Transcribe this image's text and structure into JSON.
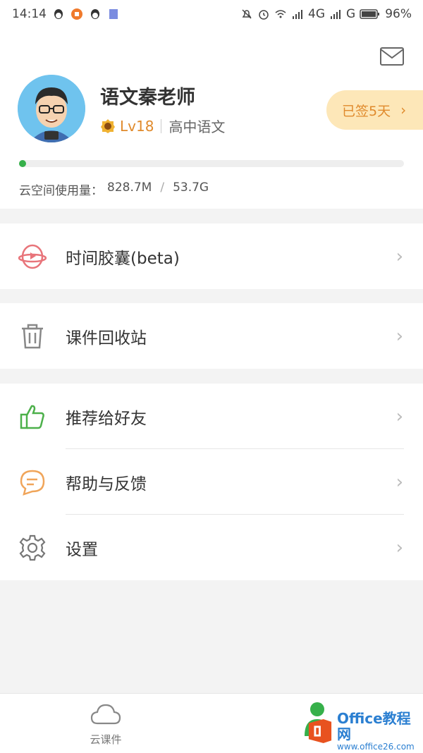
{
  "status_bar": {
    "time": "14:14",
    "network": "4G",
    "network2": "G",
    "battery": "96%"
  },
  "profile": {
    "name": "语文秦老师",
    "level": "Lv18",
    "subject": "高中语文",
    "checkin_label": "已签5天",
    "storage_label": "云空间使用量：",
    "storage_used": "828.7M",
    "storage_total": "53.7G",
    "storage_progress_percent": 1.5
  },
  "menu_groups": [
    {
      "items": [
        {
          "label": "时间胶囊(beta)",
          "icon": "capsule-icon"
        }
      ]
    },
    {
      "items": [
        {
          "label": "课件回收站",
          "icon": "trash-icon"
        }
      ]
    },
    {
      "items": [
        {
          "label": "推荐给好友",
          "icon": "thumbs-up-icon"
        },
        {
          "label": "帮助与反馈",
          "icon": "chat-bubble-icon"
        },
        {
          "label": "设置",
          "icon": "gear-icon"
        }
      ]
    }
  ],
  "tabbar": {
    "cloud_label": "云课件"
  },
  "watermark": {
    "title": "Office教程网",
    "url": "www.office26.com"
  },
  "colors": {
    "accent_green": "#36b04a",
    "checkin_bg": "#fde7b8",
    "checkin_text": "#e08a2c"
  }
}
